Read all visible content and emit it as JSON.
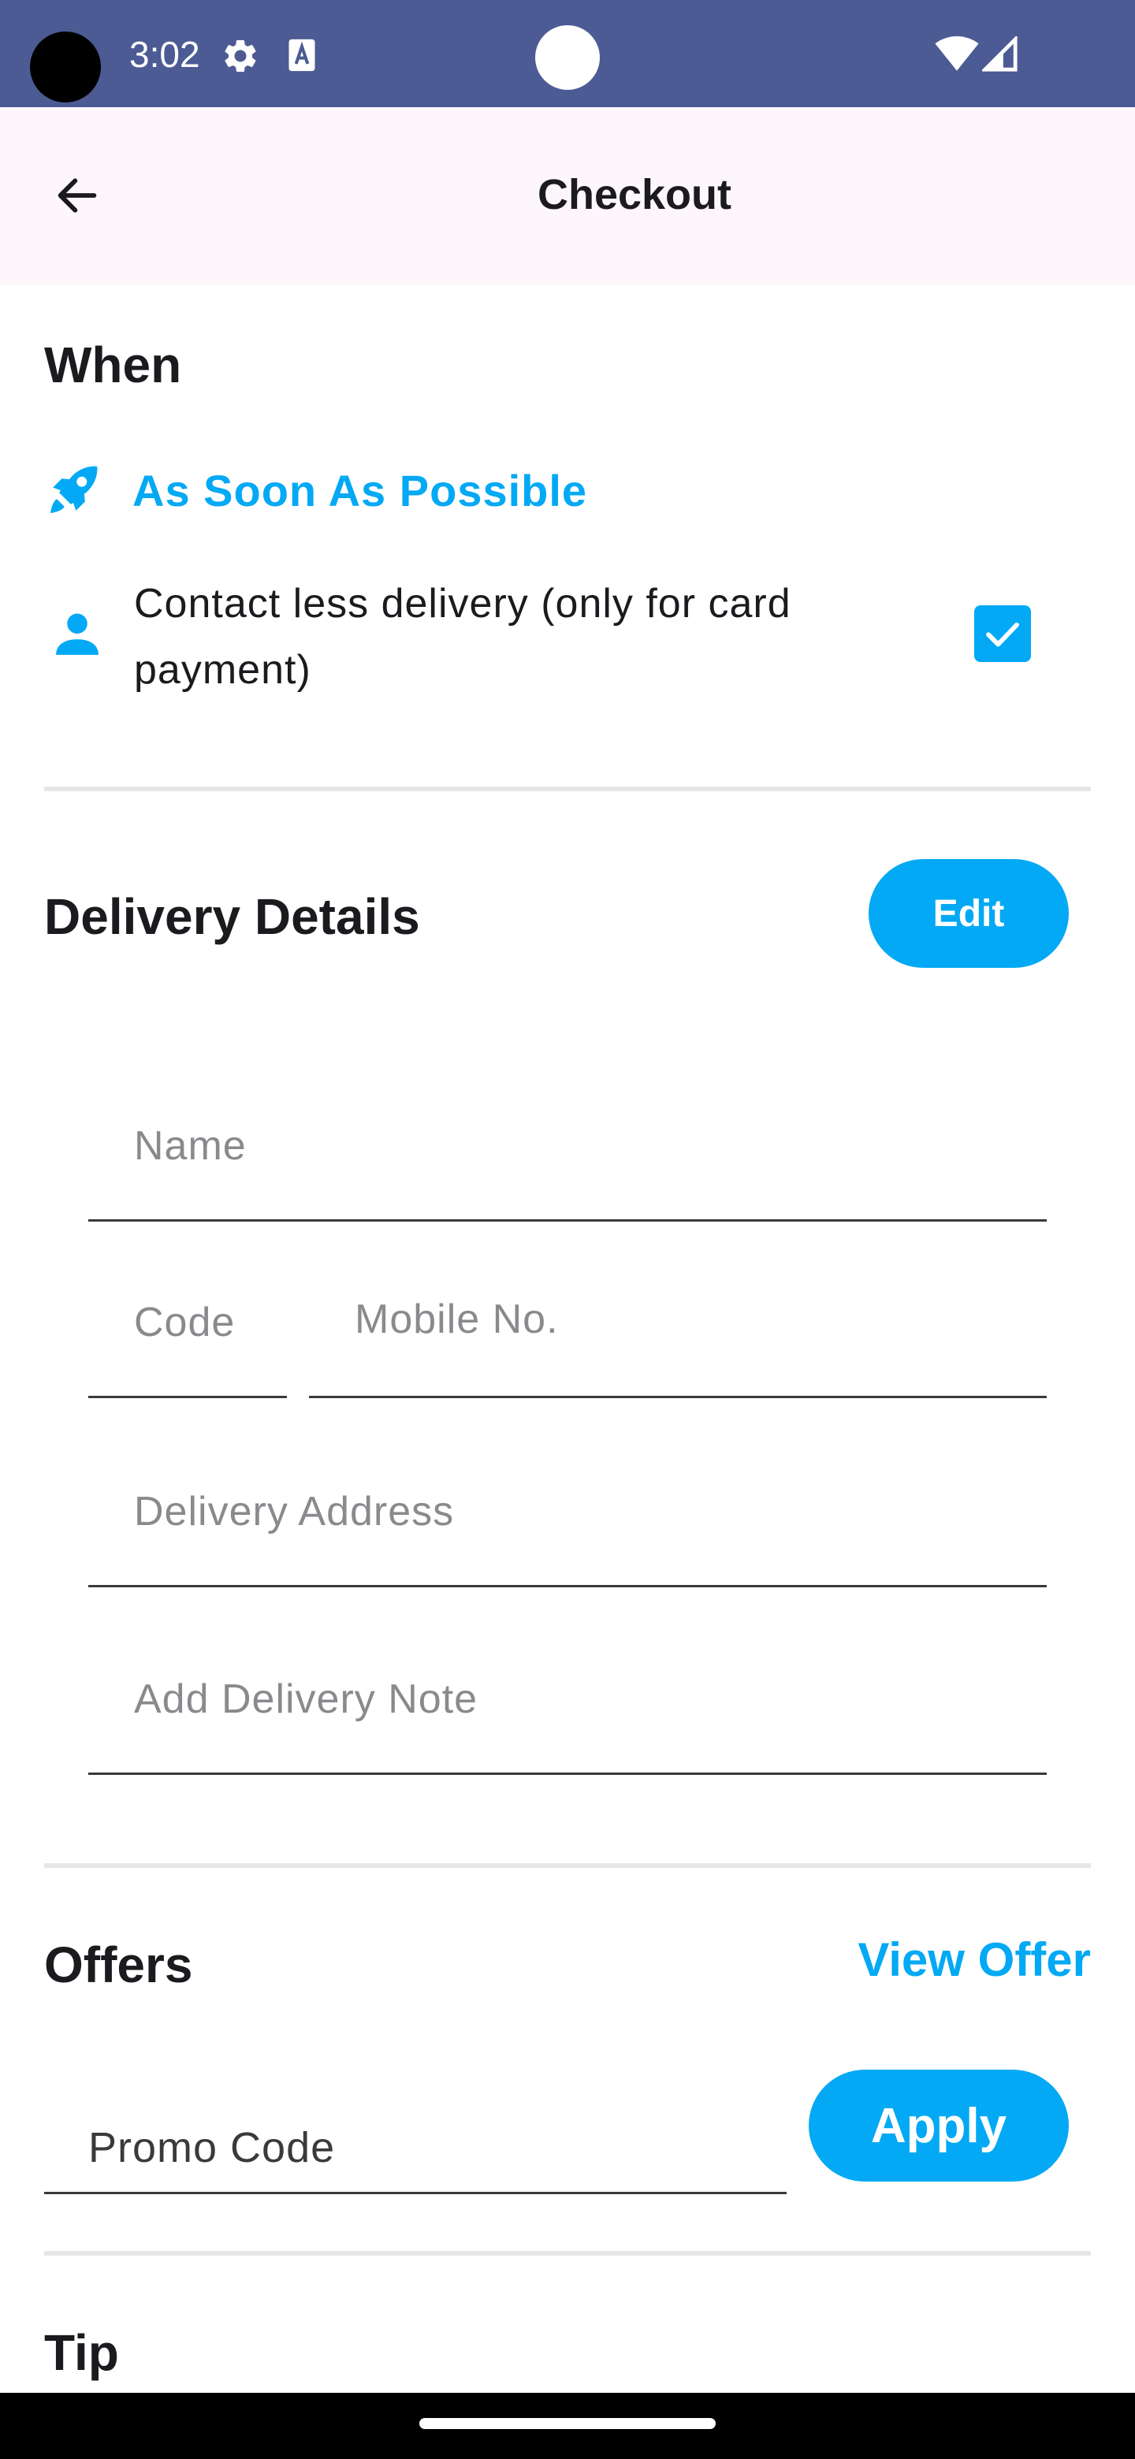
{
  "status_bar": {
    "time": "3:02",
    "icons": [
      "gear-icon",
      "text-a-icon",
      "wifi-icon",
      "signal-icon"
    ],
    "background": "#4c5b93"
  },
  "app_bar": {
    "title": "Checkout",
    "back_icon": "arrow-left-icon"
  },
  "when": {
    "title": "When",
    "asap_label": "As Soon As Possible",
    "asap_icon": "rocket-icon",
    "contactless_label": "Contact less delivery (only for card payment)",
    "contactless_icon": "person-icon",
    "contactless_checked": true
  },
  "delivery": {
    "title": "Delivery Details",
    "edit_label": "Edit",
    "fields": {
      "name_placeholder": "Name",
      "code_placeholder": "Code",
      "mobile_placeholder": "Mobile No.",
      "address_placeholder": "Delivery Address",
      "note_placeholder": "Add Delivery Note"
    }
  },
  "offers": {
    "title": "Offers",
    "view_offer_label": "View Offer",
    "promo_placeholder": "Promo Code",
    "apply_label": "Apply"
  },
  "tip": {
    "title": "Tip"
  },
  "colors": {
    "accent": "#03a9f4",
    "status_bar": "#4c5b93",
    "app_bar": "#fdf7fc"
  }
}
